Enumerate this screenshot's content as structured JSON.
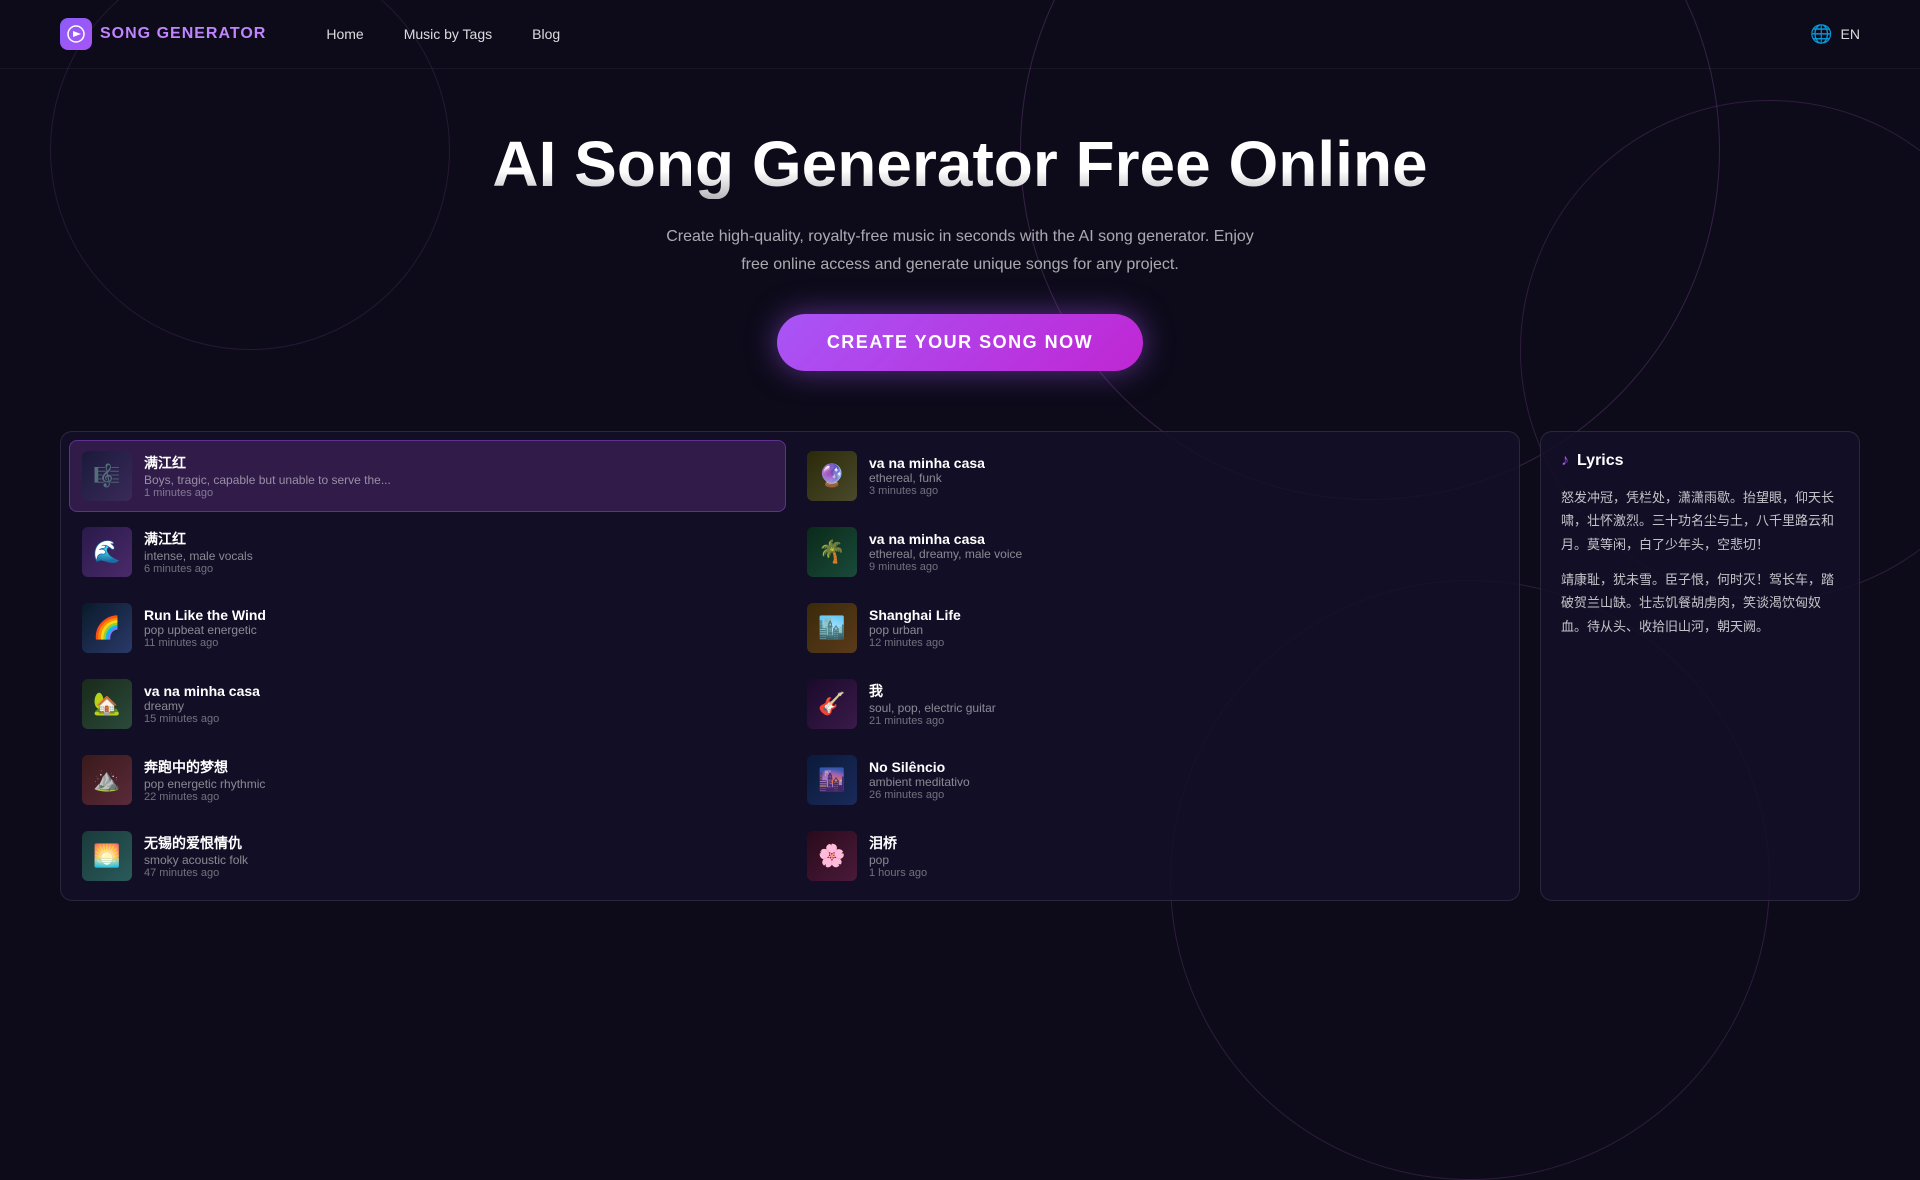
{
  "brand": {
    "logo_icon": "🎵",
    "logo_prefix": "SONG",
    "logo_suffix": " GENERATOR"
  },
  "nav": {
    "links": [
      {
        "label": "Home",
        "name": "nav-home"
      },
      {
        "label": "Music by Tags",
        "name": "nav-music-by-tags"
      },
      {
        "label": "Blog",
        "name": "nav-blog"
      }
    ],
    "lang_icon": "🌐",
    "lang": "EN"
  },
  "hero": {
    "title": "AI Song Generator Free Online",
    "subtitle": "Create high-quality, royalty-free music in seconds with the AI song generator. Enjoy free online access and generate unique songs for any project.",
    "cta": "CREATE YOUR SONG NOW"
  },
  "songs_left": [
    {
      "title": "满江红",
      "tags": "Boys, tragic, capable but unable to serve the...",
      "time": "1 minutes ago",
      "thumb": "thumb-1",
      "emoji": "🎼",
      "active": true
    },
    {
      "title": "满江红",
      "tags": "intense, male vocals",
      "time": "6 minutes ago",
      "thumb": "thumb-2",
      "emoji": "🌊",
      "active": false
    },
    {
      "title": "Run Like the Wind",
      "tags": "pop upbeat energetic",
      "time": "11 minutes ago",
      "thumb": "thumb-3",
      "emoji": "🌈",
      "active": false
    },
    {
      "title": "va na minha casa",
      "tags": "dreamy",
      "time": "15 minutes ago",
      "thumb": "thumb-4",
      "emoji": "🏡",
      "active": false
    },
    {
      "title": "奔跑中的梦想",
      "tags": "pop energetic rhythmic",
      "time": "22 minutes ago",
      "thumb": "thumb-5",
      "emoji": "⛰️",
      "active": false
    },
    {
      "title": "无锡的爱恨情仇",
      "tags": "smoky acoustic folk",
      "time": "47 minutes ago",
      "thumb": "thumb-6",
      "emoji": "🌅",
      "active": false
    }
  ],
  "songs_right": [
    {
      "title": "va na minha casa",
      "tags": "ethereal, funk",
      "time": "3 minutes ago",
      "thumb": "thumb-7",
      "emoji": "🔮",
      "active": false
    },
    {
      "title": "va na minha casa",
      "tags": "ethereal, dreamy, male voice",
      "time": "9 minutes ago",
      "thumb": "thumb-8",
      "emoji": "🌴",
      "active": false
    },
    {
      "title": "Shanghai Life",
      "tags": "pop urban",
      "time": "12 minutes ago",
      "thumb": "thumb-9",
      "emoji": "🏙️",
      "active": false
    },
    {
      "title": "我",
      "tags": "soul, pop, electric guitar",
      "time": "21 minutes ago",
      "thumb": "thumb-10",
      "emoji": "🎸",
      "active": false
    },
    {
      "title": "No Silêncio",
      "tags": "ambient meditativo",
      "time": "26 minutes ago",
      "thumb": "thumb-11",
      "emoji": "🌆",
      "active": false
    },
    {
      "title": "泪桥",
      "tags": "pop",
      "time": "1 hours ago",
      "thumb": "thumb-12",
      "emoji": "🌸",
      "active": false
    }
  ],
  "lyrics": {
    "title": "Lyrics",
    "icon": "♪",
    "paragraphs": [
      "怒发冲冠，凭栏处，潇潇雨歇。抬望眼，仰天长啸，壮怀激烈。三十功名尘与土，八千里路云和月。莫等闲，白了少年头，空悲切！",
      "靖康耻，犹未雪。臣子恨，何时灭！驾长车，踏破贺兰山缺。壮志饥餐胡虏肉，笑谈渴饮匈奴血。待从头、收拾旧山河，朝天阙。"
    ]
  }
}
